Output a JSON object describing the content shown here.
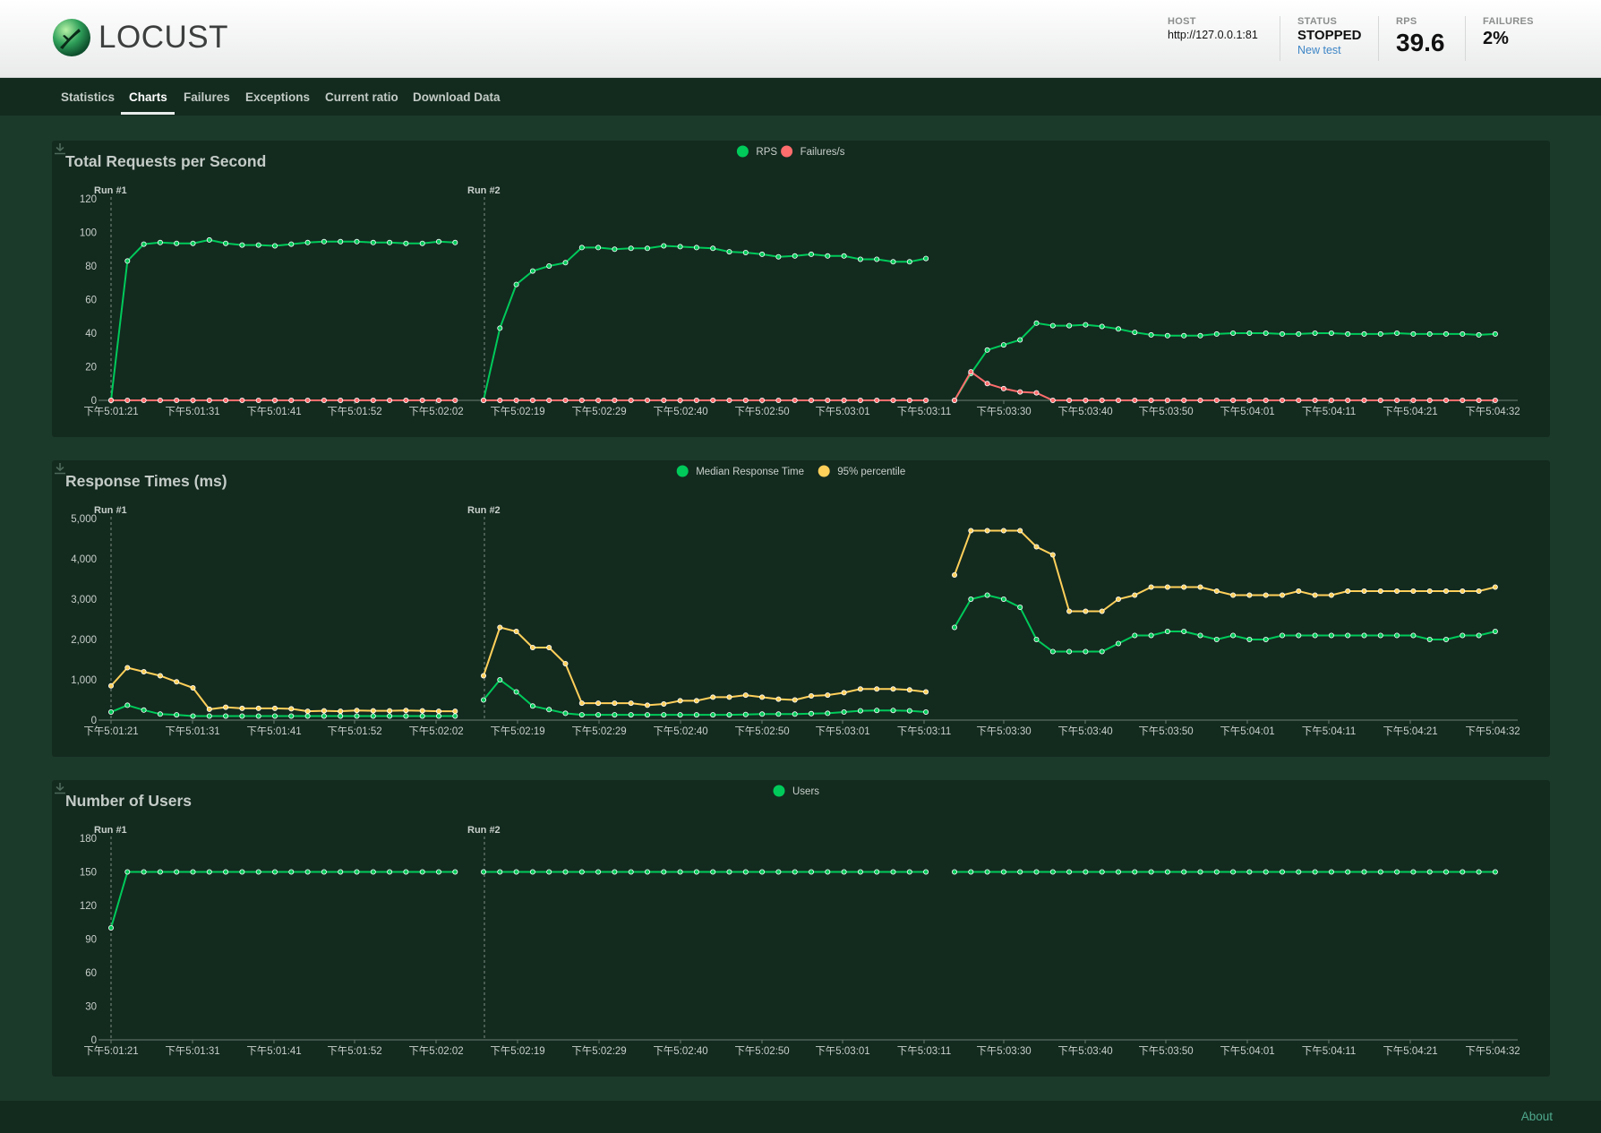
{
  "app": {
    "logo_text": "LOCUST",
    "host_label": "HOST",
    "host_value": "http://127.0.0.1:81",
    "status_label": "STATUS",
    "status_value": "STOPPED",
    "new_test_label": "New test",
    "rps_label": "RPS",
    "rps_value": "39.6",
    "failures_label": "FAILURES",
    "failures_value": "2%"
  },
  "nav": {
    "tabs": [
      {
        "label": "Statistics",
        "active": false
      },
      {
        "label": "Charts",
        "active": true
      },
      {
        "label": "Failures",
        "active": false
      },
      {
        "label": "Exceptions",
        "active": false
      },
      {
        "label": "Current ratio",
        "active": false
      },
      {
        "label": "Download Data",
        "active": false
      }
    ]
  },
  "footer": {
    "about_label": "About"
  },
  "colors": {
    "green": "#00ca5a",
    "red": "#ff6d6d",
    "yellow": "#ffd05a"
  },
  "chart_data": [
    {
      "type": "line",
      "title": "Total Requests per Second",
      "ylim": [
        0,
        120
      ],
      "yticks": [
        "0",
        "20",
        "40",
        "60",
        "80",
        "100",
        "120"
      ],
      "xticks": [
        "下午5:01:21",
        "下午5:01:31",
        "下午5:01:41",
        "下午5:01:52",
        "下午5:02:02",
        "下午5:02:19",
        "下午5:02:29",
        "下午5:02:40",
        "下午5:02:50",
        "下午5:03:01",
        "下午5:03:11",
        "下午5:03:30",
        "下午5:03:40",
        "下午5:03:50",
        "下午5:04:01",
        "下午5:04:11",
        "下午5:04:21",
        "下午5:04:32"
      ],
      "runs": [
        "Run #1",
        "Run #2"
      ],
      "legend": "top-center",
      "series": [
        {
          "name": "RPS",
          "color": "#00ca5a",
          "segments": [
            [
              0,
              83,
              93,
              94,
              93.5,
              93.5,
              95.5,
              93.5,
              92.5,
              92.5,
              92,
              93,
              94,
              94.5,
              94.5,
              94.5,
              94,
              94,
              93.5,
              93.5,
              94.5,
              94
            ],
            [
              0,
              43,
              69,
              77,
              80,
              82,
              91,
              91,
              90,
              90.5,
              90.5,
              92,
              91.5,
              91,
              90.5,
              88.5,
              88,
              87,
              85.5,
              86,
              87,
              86,
              86,
              84,
              84,
              82.5,
              82.5,
              84.5
            ],
            [
              0,
              16,
              30,
              33,
              36,
              46,
              44.5,
              44.5,
              45,
              44,
              42.5,
              40.5,
              39,
              38.5,
              38.5,
              38.5,
              39.5,
              40,
              40,
              40,
              39.5,
              39.5,
              40,
              40,
              39.5,
              39.5,
              39.5,
              40,
              39.5,
              39.5,
              39.5,
              39.5,
              39,
              39.5
            ]
          ]
        },
        {
          "name": "Failures/s",
          "color": "#ff6d6d",
          "segments": [
            [
              0,
              0,
              0,
              0,
              0,
              0,
              0,
              0,
              0,
              0,
              0,
              0,
              0,
              0,
              0,
              0,
              0,
              0,
              0,
              0,
              0,
              0
            ],
            [
              0,
              0,
              0,
              0,
              0,
              0,
              0,
              0,
              0,
              0,
              0,
              0,
              0,
              0,
              0,
              0,
              0,
              0,
              0,
              0,
              0,
              0,
              0,
              0,
              0,
              0,
              0,
              0
            ],
            [
              0,
              17,
              10,
              7,
              5,
              4.5,
              0,
              0,
              0,
              0,
              0,
              0,
              0,
              0,
              0,
              0,
              0,
              0,
              0,
              0,
              0,
              0,
              0,
              0,
              0,
              0,
              0,
              0,
              0,
              0,
              0,
              0,
              0,
              0
            ]
          ]
        }
      ]
    },
    {
      "type": "line",
      "title": "Response Times (ms)",
      "ylim": [
        0,
        5000
      ],
      "yticks": [
        "0",
        "1,000",
        "2,000",
        "3,000",
        "4,000",
        "5,000"
      ],
      "xticks": [
        "下午5:01:21",
        "下午5:01:31",
        "下午5:01:41",
        "下午5:01:52",
        "下午5:02:02",
        "下午5:02:19",
        "下午5:02:29",
        "下午5:02:40",
        "下午5:02:50",
        "下午5:03:01",
        "下午5:03:11",
        "下午5:03:30",
        "下午5:03:40",
        "下午5:03:50",
        "下午5:04:01",
        "下午5:04:11",
        "下午5:04:21",
        "下午5:04:32"
      ],
      "runs": [
        "Run #1",
        "Run #2"
      ],
      "legend": "top-center",
      "series": [
        {
          "name": "Median Response Time",
          "color": "#00ca5a",
          "segments": [
            [
              200,
              370,
              250,
              150,
              130,
              100,
              100,
              100,
              100,
              100,
              100,
              100,
              100,
              100,
              100,
              100,
              100,
              100,
              100,
              100,
              100,
              100
            ],
            [
              500,
              1000,
              700,
              350,
              260,
              170,
              130,
              130,
              130,
              130,
              130,
              130,
              130,
              130,
              130,
              130,
              140,
              150,
              150,
              150,
              160,
              170,
              200,
              230,
              240,
              240,
              230,
              200
            ],
            [
              2300,
              3000,
              3100,
              3000,
              2800,
              2000,
              1700,
              1700,
              1700,
              1700,
              1900,
              2100,
              2100,
              2200,
              2200,
              2100,
              2000,
              2100,
              2000,
              2000,
              2100,
              2100,
              2100,
              2100,
              2100,
              2100,
              2100,
              2100,
              2100,
              2000,
              2000,
              2100,
              2100,
              2200
            ]
          ]
        },
        {
          "name": "95% percentile",
          "color": "#ffd05a",
          "segments": [
            [
              850,
              1300,
              1200,
              1100,
              950,
              800,
              270,
              320,
              290,
              290,
              290,
              280,
              220,
              230,
              220,
              240,
              230,
              230,
              240,
              230,
              220,
              220
            ],
            [
              1100,
              2300,
              2200,
              1800,
              1800,
              1400,
              420,
              420,
              420,
              420,
              370,
              400,
              480,
              480,
              570,
              570,
              620,
              570,
              520,
              500,
              600,
              620,
              680,
              770,
              770,
              770,
              750,
              700
            ],
            [
              3600,
              4700,
              4700,
              4700,
              4700,
              4300,
              4100,
              2700,
              2700,
              2700,
              3000,
              3100,
              3300,
              3300,
              3300,
              3300,
              3200,
              3100,
              3100,
              3100,
              3100,
              3200,
              3100,
              3100,
              3200,
              3200,
              3200,
              3200,
              3200,
              3200,
              3200,
              3200,
              3200,
              3300
            ]
          ]
        }
      ]
    },
    {
      "type": "line",
      "title": "Number of Users",
      "ylim": [
        0,
        180
      ],
      "yticks": [
        "0",
        "30",
        "60",
        "90",
        "120",
        "150",
        "180"
      ],
      "xticks": [
        "下午5:01:21",
        "下午5:01:31",
        "下午5:01:41",
        "下午5:01:52",
        "下午5:02:02",
        "下午5:02:19",
        "下午5:02:29",
        "下午5:02:40",
        "下午5:02:50",
        "下午5:03:01",
        "下午5:03:11",
        "下午5:03:30",
        "下午5:03:40",
        "下午5:03:50",
        "下午5:04:01",
        "下午5:04:11",
        "下午5:04:21",
        "下午5:04:32"
      ],
      "runs": [
        "Run #1",
        "Run #2"
      ],
      "legend": "top-center",
      "series": [
        {
          "name": "Users",
          "color": "#00ca5a",
          "segments": [
            [
              100,
              150,
              150,
              150,
              150,
              150,
              150,
              150,
              150,
              150,
              150,
              150,
              150,
              150,
              150,
              150,
              150,
              150,
              150,
              150,
              150,
              150
            ],
            [
              150,
              150,
              150,
              150,
              150,
              150,
              150,
              150,
              150,
              150,
              150,
              150,
              150,
              150,
              150,
              150,
              150,
              150,
              150,
              150,
              150,
              150,
              150,
              150,
              150,
              150,
              150,
              150
            ],
            [
              150,
              150,
              150,
              150,
              150,
              150,
              150,
              150,
              150,
              150,
              150,
              150,
              150,
              150,
              150,
              150,
              150,
              150,
              150,
              150,
              150,
              150,
              150,
              150,
              150,
              150,
              150,
              150,
              150,
              150,
              150,
              150,
              150,
              150
            ]
          ]
        }
      ]
    }
  ]
}
